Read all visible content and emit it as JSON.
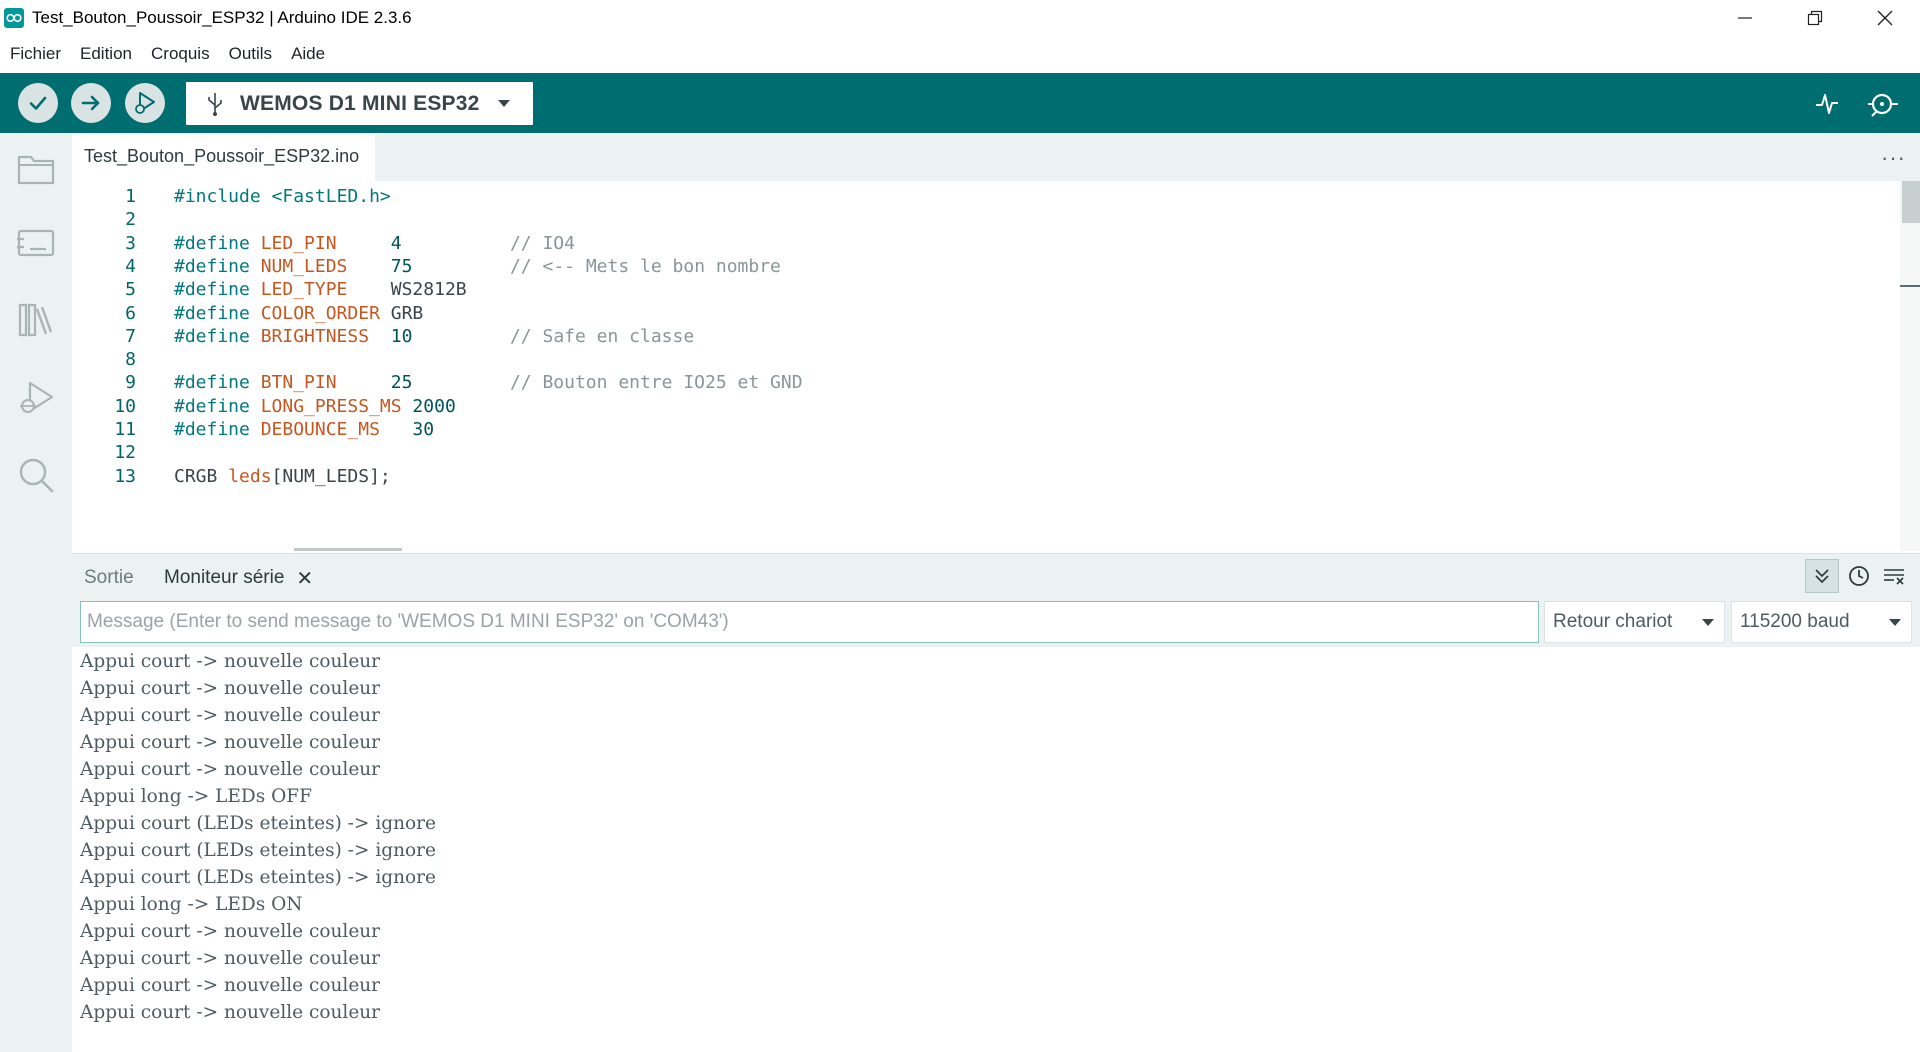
{
  "window": {
    "title": "Test_Bouton_Poussoir_ESP32 | Arduino IDE 2.3.6"
  },
  "menu": [
    "Fichier",
    "Edition",
    "Croquis",
    "Outils",
    "Aide"
  ],
  "toolbar": {
    "board": "WEMOS D1 MINI ESP32",
    "verify_icon": "check-icon",
    "upload_icon": "arrow-right-icon",
    "debug_icon": "debug-play-icon"
  },
  "editor": {
    "tab": "Test_Bouton_Poussoir_ESP32.ino",
    "more": "···",
    "lines": [
      {
        "n": "1",
        "parts": [
          {
            "t": "#include ",
            "c": "kw"
          },
          {
            "t": "<FastLED.h>",
            "c": "kw"
          }
        ]
      },
      {
        "n": "2",
        "parts": []
      },
      {
        "n": "3",
        "parts": [
          {
            "t": "#define ",
            "c": "kw"
          },
          {
            "t": "LED_PIN",
            "c": "mc"
          },
          {
            "t": "     4          ",
            "c": "num"
          },
          {
            "t": "// IO4",
            "c": "cm"
          }
        ]
      },
      {
        "n": "4",
        "parts": [
          {
            "t": "#define ",
            "c": "kw"
          },
          {
            "t": "NUM_LEDS",
            "c": "mc"
          },
          {
            "t": "    75         ",
            "c": "num"
          },
          {
            "t": "// <-- Mets le bon nombre",
            "c": "cm"
          }
        ]
      },
      {
        "n": "5",
        "parts": [
          {
            "t": "#define ",
            "c": "kw"
          },
          {
            "t": "LED_TYPE",
            "c": "mc"
          },
          {
            "t": "    WS2812B",
            "c": ""
          }
        ]
      },
      {
        "n": "6",
        "parts": [
          {
            "t": "#define ",
            "c": "kw"
          },
          {
            "t": "COLOR_ORDER",
            "c": "mc"
          },
          {
            "t": " GRB",
            "c": ""
          }
        ]
      },
      {
        "n": "7",
        "parts": [
          {
            "t": "#define ",
            "c": "kw"
          },
          {
            "t": "BRIGHTNESS",
            "c": "mc"
          },
          {
            "t": "  10         ",
            "c": "num"
          },
          {
            "t": "// Safe en classe",
            "c": "cm"
          }
        ]
      },
      {
        "n": "8",
        "parts": []
      },
      {
        "n": "9",
        "parts": [
          {
            "t": "#define ",
            "c": "kw"
          },
          {
            "t": "BTN_PIN",
            "c": "mc"
          },
          {
            "t": "     25         ",
            "c": "num"
          },
          {
            "t": "// Bouton entre IO25 et GND",
            "c": "cm"
          }
        ]
      },
      {
        "n": "10",
        "parts": [
          {
            "t": "#define ",
            "c": "kw"
          },
          {
            "t": "LONG_PRESS_MS",
            "c": "mc"
          },
          {
            "t": " 2000",
            "c": "num"
          }
        ]
      },
      {
        "n": "11",
        "parts": [
          {
            "t": "#define ",
            "c": "kw"
          },
          {
            "t": "DEBOUNCE_MS",
            "c": "mc"
          },
          {
            "t": "   30",
            "c": "num"
          }
        ]
      },
      {
        "n": "12",
        "parts": []
      },
      {
        "n": "13",
        "parts": [
          {
            "t": "CRGB ",
            "c": ""
          },
          {
            "t": "leds",
            "c": "mc"
          },
          {
            "t": "[NUM_LEDS];",
            "c": ""
          }
        ]
      }
    ]
  },
  "panel": {
    "tab_output": "Sortie",
    "tab_monitor": "Moniteur série",
    "close": "✕",
    "message_placeholder": "Message (Enter to send message to 'WEMOS D1 MINI ESP32' on 'COM43')",
    "line_ending": "Retour chariot",
    "baud": "115200 baud",
    "output": [
      "Appui court -> nouvelle couleur",
      "Appui court -> nouvelle couleur",
      "Appui court -> nouvelle couleur",
      "Appui court -> nouvelle couleur",
      "Appui court -> nouvelle couleur",
      "Appui long -> LEDs OFF",
      "Appui court (LEDs eteintes) -> ignore",
      "Appui court (LEDs eteintes) -> ignore",
      "Appui court (LEDs eteintes) -> ignore",
      "Appui long -> LEDs ON",
      "Appui court -> nouvelle couleur",
      "Appui court -> nouvelle couleur",
      "Appui court -> nouvelle couleur",
      "Appui court -> nouvelle couleur"
    ]
  },
  "colors": {
    "toolbar": "#006d70",
    "sidebar": "#ecf1f1",
    "keyword": "#00797d",
    "macro": "#c7561f",
    "comment": "#8a9598"
  }
}
